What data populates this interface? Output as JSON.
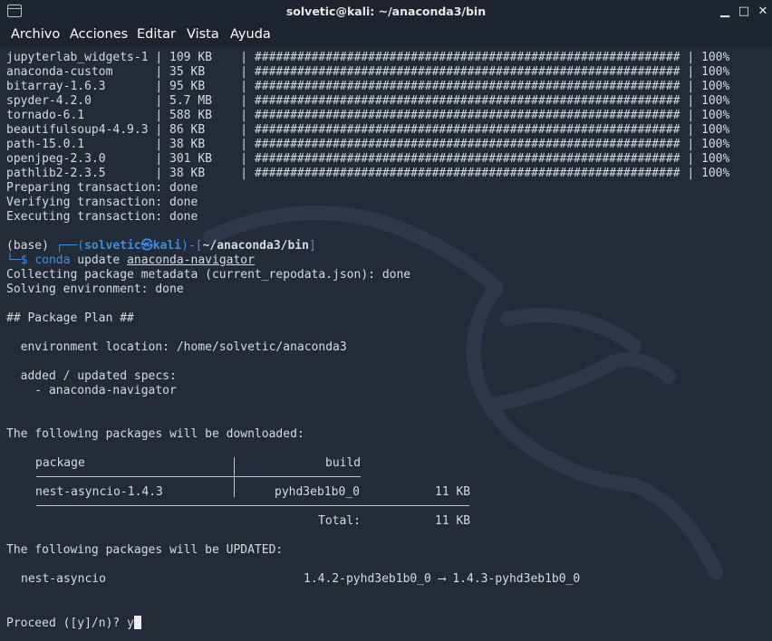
{
  "window": {
    "title": "solvetic@kali: ~/anaconda3/bin",
    "minimize_glyph": "▁",
    "maximize_glyph": "□",
    "close_glyph": "✕"
  },
  "menu": [
    "Archivo",
    "Acciones",
    "Editar",
    "Vista",
    "Ayuda"
  ],
  "terminal": {
    "downloads": [
      {
        "text": "jupyterlab_widgets-1 | 109 KB    | ############################################################ | 100%"
      },
      {
        "text": "anaconda-custom      | 35 KB     | ############################################################ | 100%"
      },
      {
        "text": "bitarray-1.6.3       | 95 KB     | ############################################################ | 100%"
      },
      {
        "text": "spyder-4.2.0         | 5.7 MB    | ############################################################ | 100%"
      },
      {
        "text": "tornado-6.1          | 588 KB    | ############################################################ | 100%"
      },
      {
        "text": "beautifulsoup4-4.9.3 | 86 KB     | ############################################################ | 100%"
      },
      {
        "text": "path-15.0.1          | 38 KB     | ############################################################ | 100%"
      },
      {
        "text": "openjpeg-2.3.0       | 301 KB    | ############################################################ | 100%"
      },
      {
        "text": "pathlib2-2.3.5       | 38 KB     | ############################################################ | 100%"
      }
    ],
    "transaction": [
      "Preparing transaction: done",
      "Verifying transaction: done",
      "Executing transaction: done"
    ],
    "prompt": {
      "env": "(base) ",
      "corner": "┌──(",
      "user": "solvetic",
      "at": "㉿",
      "host": "kali",
      "mid": ")-[",
      "path": "~/anaconda3/bin",
      "end": "]",
      "corner2": "└─$ ",
      "cmd": "conda",
      "cmd_rest": " update ",
      "cmd_arg": "anaconda-navigator"
    },
    "collecting": "Collecting package metadata (current_repodata.json): done",
    "solving": "Solving environment: done",
    "plan_header": "## Package Plan ##",
    "env_location": "  environment location: /home/solvetic/anaconda3",
    "specs_header": "  added / updated specs:",
    "specs_item": "    - anaconda-navigator",
    "download_header": "The following packages will be downloaded:",
    "table": {
      "col_package": "package",
      "col_build": "build",
      "pkg_name": "nest-asyncio-1.4.3",
      "pkg_build": "pyhd3eb1b0_0",
      "pkg_size": "11 KB",
      "total_label": "Total:",
      "total_size": "11 KB"
    },
    "updated_header": "The following packages will be UPDATED:",
    "updated": {
      "name": "nest-asyncio",
      "versions": "1.4.2-pyhd3eb1b0_0 ⟶ 1.4.3-pyhd3eb1b0_0"
    },
    "proceed": "Proceed ([y]/n)? ",
    "input": "y"
  }
}
